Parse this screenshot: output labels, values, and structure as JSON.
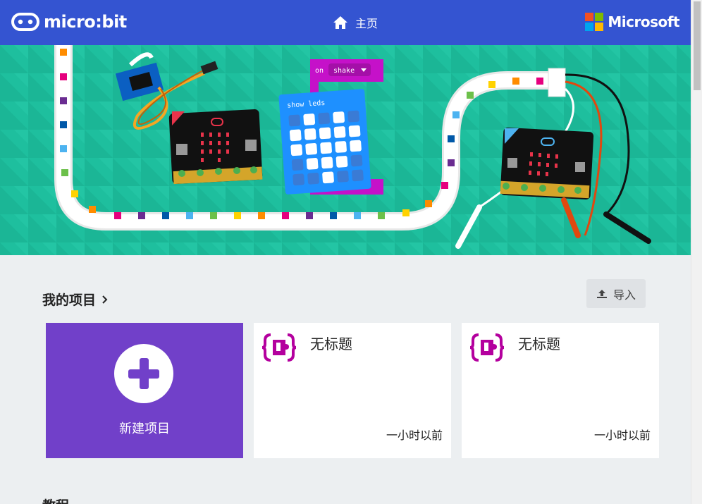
{
  "header": {
    "logo_text": "micro:bit",
    "home_label": "主页",
    "brand_text": "Microsoft",
    "brand_colors": [
      "#f25022",
      "#7fba00",
      "#00a4ef",
      "#ffb900"
    ]
  },
  "hero": {
    "block_event": "on",
    "block_event_value": "shake",
    "block_action": "show leds"
  },
  "projects": {
    "title": "我的项目",
    "import_label": "导入",
    "new_project_label": "新建项目",
    "items": [
      {
        "title": "无标题",
        "time": "一小时以前"
      },
      {
        "title": "无标题",
        "time": "一小时以前"
      }
    ]
  },
  "tutorials": {
    "title": "教程"
  },
  "colors": {
    "header": "#3454d1",
    "hero": "#1ebf9e",
    "new_card": "#7140c9",
    "page_bg": "#eceff1",
    "puzzle": "#b4009e"
  }
}
